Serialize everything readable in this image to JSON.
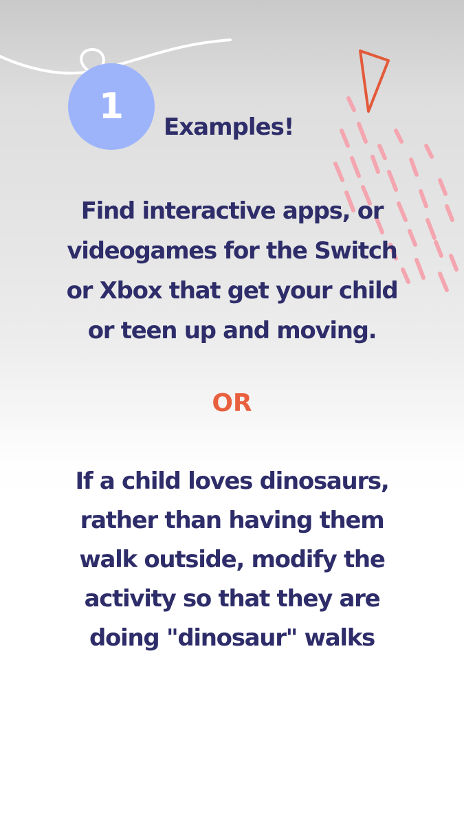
{
  "badge": {
    "number": "1"
  },
  "heading": "Examples!",
  "paragraph1": {
    "lines": [
      "Find interactive apps, or",
      "videogames for the Switch",
      "or Xbox that get your child",
      "or teen up and moving."
    ]
  },
  "separator": "OR",
  "paragraph2": {
    "lines": [
      "If a child loves dinosaurs,",
      "rather than having them",
      "walk outside, modify the",
      "activity so that they are",
      "doing \"dinosaur\" walks"
    ]
  },
  "colors": {
    "text": "#2e2d6a",
    "accent": "#e9603f",
    "badge": "#9db4fb",
    "dashes": "#f4a6b0"
  }
}
